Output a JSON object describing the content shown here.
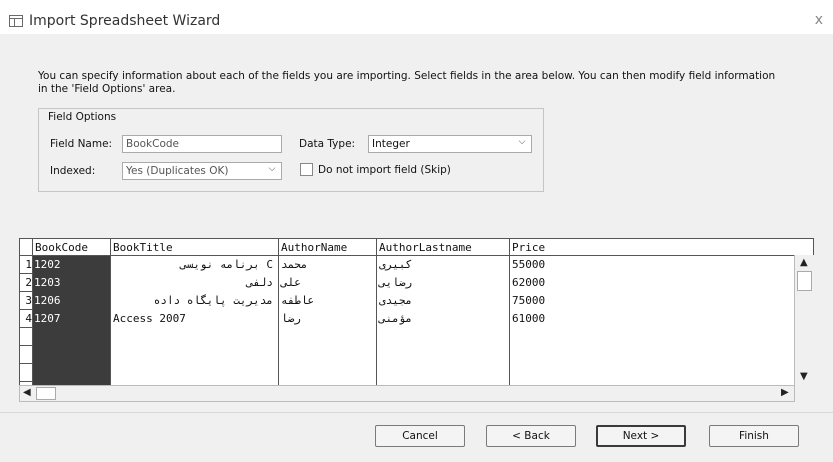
{
  "window": {
    "title": "Import Spreadsheet Wizard",
    "close_glyph": "x"
  },
  "intro_text": "You can specify information about each of the fields you are importing.  Select fields in the area below. You can then modify field information in the 'Field Options' area.",
  "field_options": {
    "legend": "Field Options",
    "field_name_label": "Field Name:",
    "field_name_value": "BookCode",
    "data_type_label": "Data Type:",
    "data_type_value": "Integer",
    "indexed_label": "Indexed:",
    "indexed_value": "Yes (Duplicates OK)",
    "skip_label": "Do not import field (Skip)",
    "skip_checked": false
  },
  "grid": {
    "headers": [
      "BookCode",
      "BookTitle",
      "AuthorName",
      "AuthorLastname",
      "Price"
    ],
    "row_numbers": [
      "1",
      "2",
      "3",
      "4"
    ],
    "rows": [
      [
        "1202",
        "C برنامه نویسی",
        "محمد",
        "کبیری",
        "55000"
      ],
      [
        "1203",
        "دلفی",
        "علی",
        "رضایی",
        "62000"
      ],
      [
        "1206",
        "مدیریت پایگاه داده",
        "عاطفه",
        "مجیدی",
        "75000"
      ],
      [
        "1207",
        "Access 2007",
        "رضا",
        "مؤمنی",
        "61000"
      ]
    ],
    "selected_column": "BookCode",
    "selected_color": "#3c3c3c"
  },
  "buttons": {
    "cancel": "Cancel",
    "back": "< Back",
    "next": "Next >",
    "finish": "Finish"
  }
}
